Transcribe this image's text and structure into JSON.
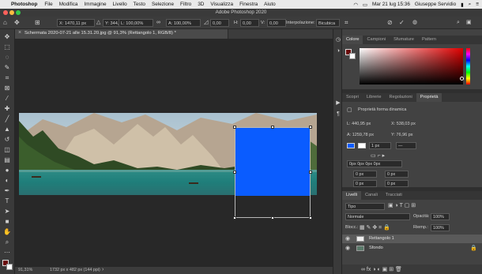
{
  "menubar": {
    "app_name": "Photoshop",
    "items": [
      "File",
      "Modifica",
      "Immagine",
      "Livello",
      "Testo",
      "Selezione",
      "Filtro",
      "3D",
      "Visualizza",
      "Finestra",
      "Aiuto"
    ],
    "datetime": "Mar 21 lug 15:36",
    "user": "Giuseppe Servidio"
  },
  "window": {
    "title": "Adobe Photoshop 2020"
  },
  "options": {
    "x": "X: 1470,11 px",
    "y": "Y: 344,88 px",
    "w": "L: 100,00%",
    "h": "A: 100,00%",
    "angle": "0,00",
    "h_skew": "0,00",
    "v_skew": "0,00",
    "interp_label": "Interpolazione:",
    "interp_value": "Bicubica"
  },
  "document": {
    "tab_label": "Schermata 2020-07-21 alle 15.31.20.jpg @ 91,3% (Rettangolo 1, RGB/8) *"
  },
  "status": {
    "zoom": "91,31%",
    "size": "1732 px x 482 px (144 ppi)"
  },
  "panels": {
    "color_tabs": [
      "Colore",
      "Campioni",
      "Sfumature",
      "Pattern"
    ],
    "props_tabs": [
      "Scopri",
      "Librerie",
      "Regolazioni",
      "Proprietà"
    ],
    "props_title": "Proprietà forma dinamica",
    "props": {
      "w": "L: 440,95 px",
      "x": "X: 538,03 px",
      "h": "A: 1259,78 px",
      "y": "Y: 76,96 px",
      "stroke": "1 px",
      "corners": "0px 0px 0px 0px",
      "c1": "0 px",
      "c2": "0 px",
      "c3": "0 px",
      "c4": "0 px"
    },
    "layers_tabs": [
      "Livelli",
      "Canali",
      "Tracciati"
    ],
    "filter_kind": "Tipo",
    "blend_mode": "Normale",
    "opacity_label": "Opacità:",
    "opacity_value": "100%",
    "lock_label": "Blocc.:",
    "fill_label": "Riemp.:",
    "fill_value": "100%",
    "layers": [
      "Rettangolo 1",
      "Sfondo"
    ]
  },
  "colors": {
    "shape_fill": "#0a5cff",
    "foreground": "#6b0a0a"
  }
}
